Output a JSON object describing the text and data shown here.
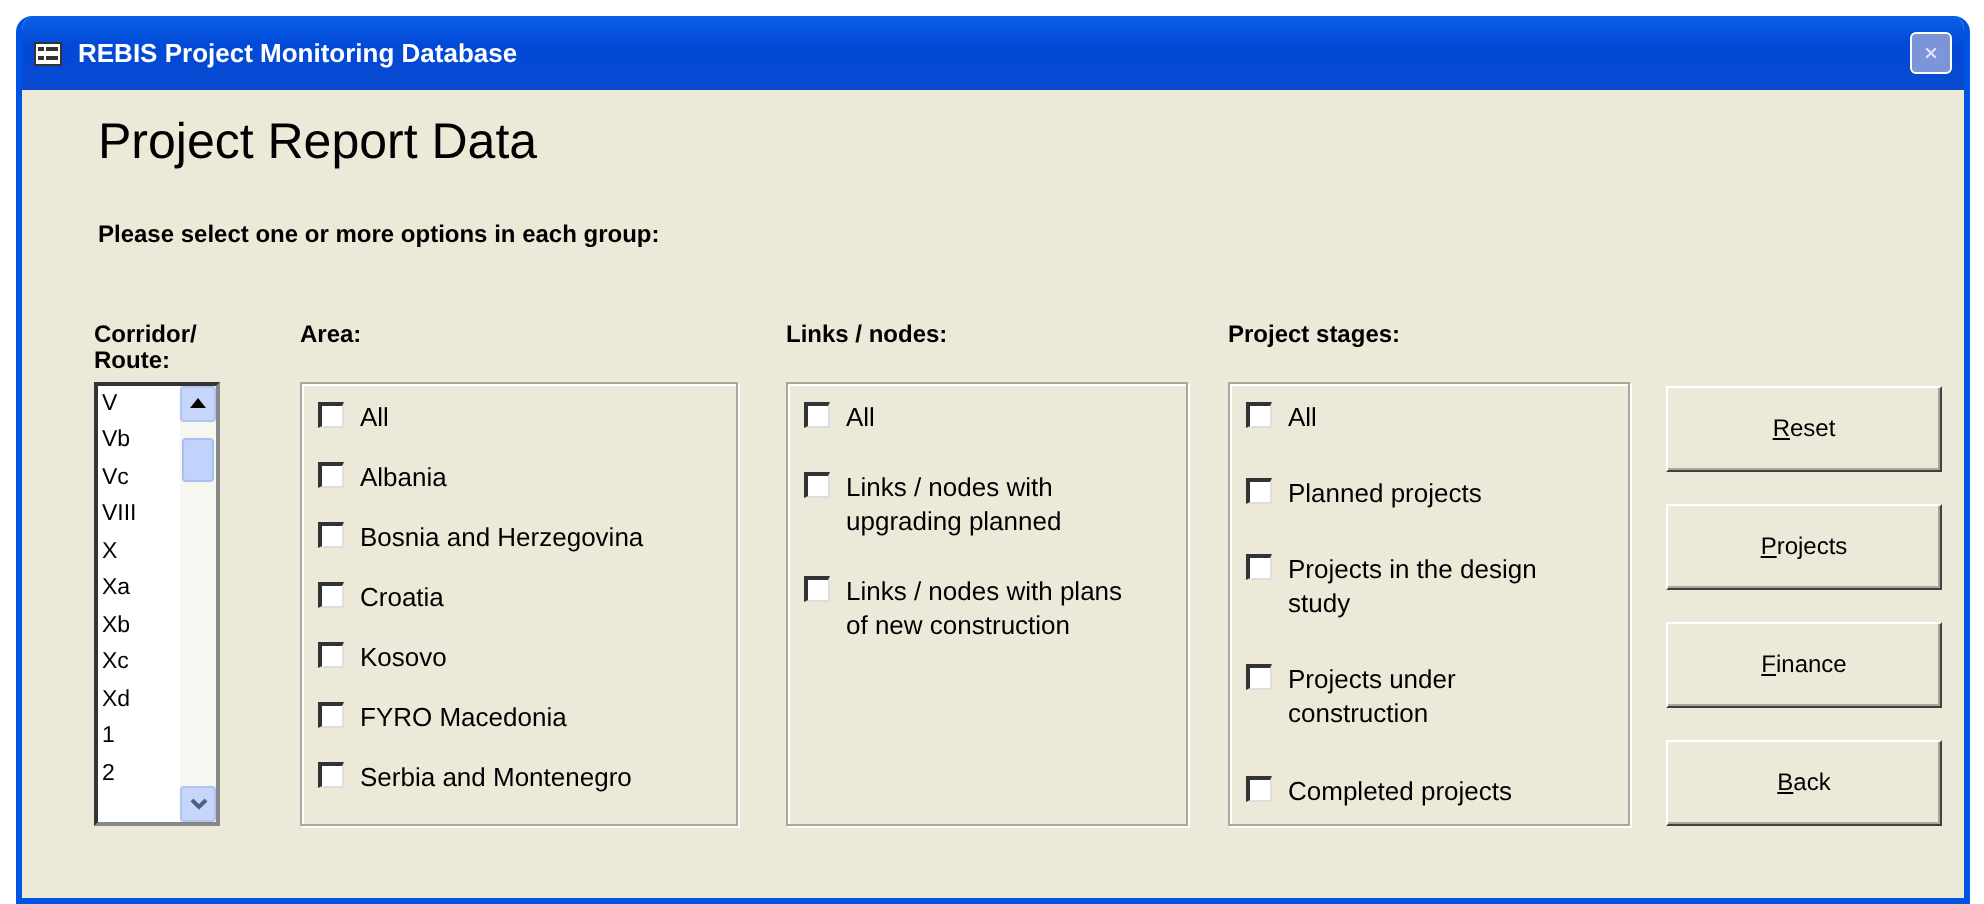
{
  "window": {
    "title": "REBIS Project Monitoring Database"
  },
  "heading": "Project Report Data",
  "instruction": "Please select one or more options in each group:",
  "corridor": {
    "label": "Corridor/ Route:",
    "items": [
      {
        "text": "V",
        "selected": false
      },
      {
        "text": "Vb",
        "selected": false
      },
      {
        "text": "Vc",
        "selected": false
      },
      {
        "text": "VIII",
        "selected": false
      },
      {
        "text": "X",
        "selected": false
      },
      {
        "text": "Xa",
        "selected": false
      },
      {
        "text": "Xb",
        "selected": false
      },
      {
        "text": "Xc",
        "selected": false
      },
      {
        "text": "Xd",
        "selected": false
      },
      {
        "text": "1",
        "selected": false
      },
      {
        "text": "2",
        "selected": false
      }
    ]
  },
  "groups": [
    {
      "label": "Area:",
      "options": [
        {
          "text": "All",
          "checked": false
        },
        {
          "text": "Albania",
          "checked": false
        },
        {
          "text": "Bosnia and Herzegovina",
          "checked": false
        },
        {
          "text": "Croatia",
          "checked": false
        },
        {
          "text": "Kosovo",
          "checked": false
        },
        {
          "text": "FYRO Macedonia",
          "checked": false
        },
        {
          "text": "Serbia and Montenegro",
          "checked": false
        }
      ]
    },
    {
      "label": "Links / nodes:",
      "options": [
        {
          "text": "All",
          "checked": false
        },
        {
          "text": "Links / nodes with upgrading planned",
          "checked": false
        },
        {
          "text": "Links / nodes with plans of new construction",
          "checked": false
        }
      ]
    },
    {
      "label": "Project stages:",
      "options": [
        {
          "text": "All",
          "checked": false
        },
        {
          "text": "Planned projects",
          "checked": false
        },
        {
          "text": "Projects in the design study",
          "checked": false
        },
        {
          "text": "Projects under construction",
          "checked": false
        },
        {
          "text": "Completed projects",
          "checked": false
        }
      ]
    }
  ],
  "buttons": [
    {
      "label": "Reset"
    },
    {
      "label": "Projects"
    },
    {
      "label": "Finance"
    },
    {
      "label": "Back"
    }
  ]
}
